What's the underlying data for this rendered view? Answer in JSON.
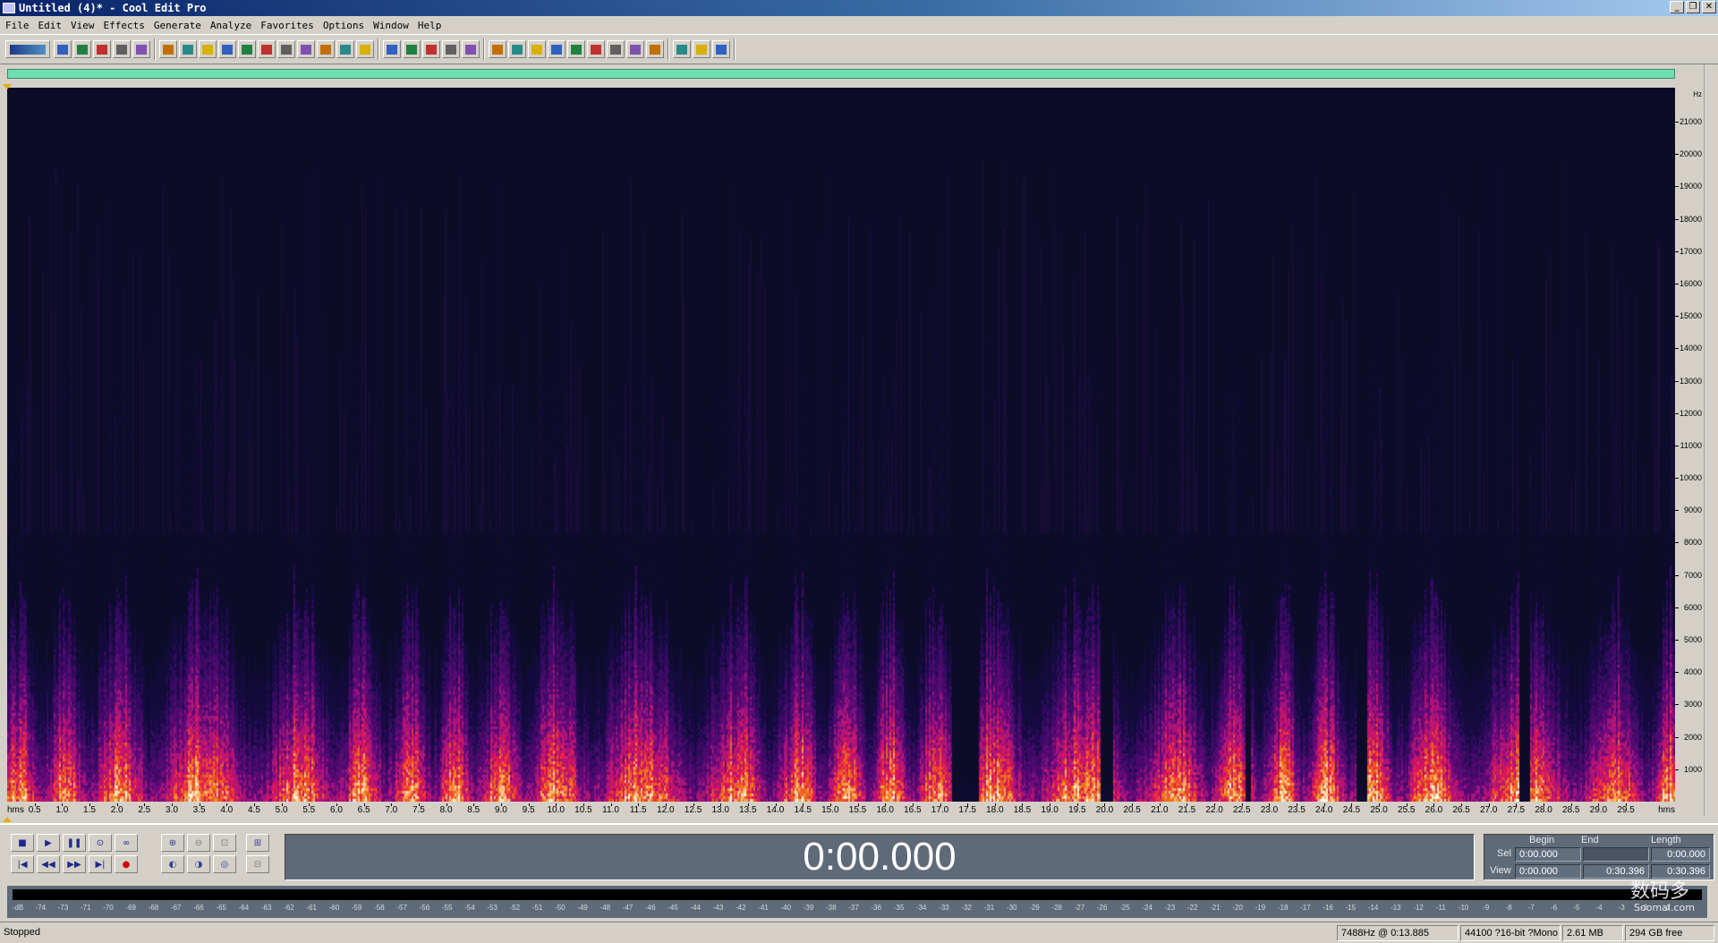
{
  "window": {
    "title": "Untitled (4)* - Cool Edit Pro",
    "controls": [
      "minimize-icon",
      "restore-icon",
      "close-icon"
    ]
  },
  "menu": [
    "File",
    "Edit",
    "View",
    "Effects",
    "Generate",
    "Analyze",
    "Favorites",
    "Options",
    "Window",
    "Help"
  ],
  "toolbar_icons": [
    "waveform-view-icon",
    "new-file-icon",
    "open-file-icon",
    "save-icon",
    "open-append-icon",
    "close-file-icon",
    "undo-icon",
    "redo-icon",
    "repeat-last-icon",
    "copy-icon",
    "copy-new-icon",
    "cut-icon",
    "trim-icon",
    "paste-icon",
    "paste-new-icon",
    "mix-paste-icon",
    "snap-icon",
    "spectral-view-icon",
    "waveform-toggle-icon",
    "zoom-fit-icon",
    "zoom-window-icon",
    "zoom-all-icon",
    "cue-list-icon",
    "play-list-icon",
    "info-icon",
    "scripts-icon",
    "cd-track-icon",
    "time-format-icon",
    "metronome-icon",
    "ruler-icon",
    "frame-icon",
    "settings-icon",
    "favorites-icon",
    "help-icon"
  ],
  "spectrogram": {
    "frequency_unit": "Hz",
    "frequency_labels": [
      "21000",
      "20000",
      "19000",
      "18000",
      "17000",
      "16000",
      "15000",
      "14000",
      "13000",
      "12000",
      "11000",
      "10000",
      "9000",
      "8000",
      "7000",
      "6000",
      "5000",
      "4000",
      "3000",
      "2000",
      "1000"
    ],
    "time_unit_left": "hms",
    "time_unit_right": "hms",
    "time_labels": [
      "0.5",
      "1.0",
      "1.5",
      "2.0",
      "2.5",
      "3.0",
      "3.5",
      "4.0",
      "4.5",
      "5.0",
      "5.5",
      "6.0",
      "6.5",
      "7.0",
      "7.5",
      "8.0",
      "8.5",
      "9.0",
      "9.5",
      "10.0",
      "10.5",
      "11.0",
      "11.5",
      "12.0",
      "12.5",
      "13.0",
      "13.5",
      "14.0",
      "14.5",
      "15.0",
      "15.5",
      "16.0",
      "16.5",
      "17.0",
      "17.5",
      "18.0",
      "18.5",
      "19.0",
      "19.5",
      "20.0",
      "20.5",
      "21.0",
      "21.5",
      "22.0",
      "22.5",
      "23.0",
      "23.5",
      "24.0",
      "24.5",
      "25.0",
      "25.5",
      "26.0",
      "26.5",
      "27.0",
      "27.5",
      "28.0",
      "28.5",
      "29.0",
      "29.5"
    ]
  },
  "transport": {
    "row1_icons": [
      "stop-icon",
      "play-icon",
      "pause-icon",
      "play-to-end-icon",
      "loop-icon"
    ],
    "row2_icons": [
      "go-to-start-icon",
      "rewind-icon",
      "fast-forward-icon",
      "go-to-end-icon",
      "record-icon"
    ],
    "row1_glyphs": [
      "■",
      "▶",
      "❚❚",
      "⊙",
      "∞"
    ],
    "row2_glyphs": [
      "|◀",
      "◀◀",
      "▶▶",
      "▶|",
      "●"
    ]
  },
  "zoom": {
    "row1_icons": [
      "zoom-in-icon",
      "zoom-out-icon",
      "zoom-full-icon",
      "zoom-vertical-in-icon"
    ],
    "row2_icons": [
      "zoom-left-icon",
      "zoom-right-icon",
      "zoom-selection-icon",
      "zoom-vertical-out-icon"
    ]
  },
  "time_display": "0:00.000",
  "selection": {
    "headers": {
      "begin": "Begin",
      "end": "End",
      "length": "Length"
    },
    "sel": {
      "label": "Sel",
      "begin": "0:00.000",
      "end": "",
      "length": "0:00.000"
    },
    "view": {
      "label": "View",
      "begin": "0:00.000",
      "end": "0:30.396",
      "length": "0:30.396"
    }
  },
  "level_meter": {
    "labels": [
      "-dB",
      "-74",
      "-73",
      "-71",
      "-70",
      "-69",
      "-68",
      "-67",
      "-66",
      "-65",
      "-64",
      "-63",
      "-62",
      "-61",
      "-60",
      "-59",
      "-58",
      "-57",
      "-56",
      "-55",
      "-54",
      "-53",
      "-52",
      "-51",
      "-50",
      "-49",
      "-48",
      "-47",
      "-46",
      "-45",
      "-44",
      "-43",
      "-42",
      "-41",
      "-40",
      "-39",
      "-38",
      "-37",
      "-36",
      "-35",
      "-34",
      "-33",
      "-32",
      "-31",
      "-30",
      "-29",
      "-28",
      "-27",
      "-26",
      "-25",
      "-24",
      "-23",
      "-22",
      "-21",
      "-20",
      "-19",
      "-18",
      "-17",
      "-16",
      "-15",
      "-14",
      "-13",
      "-12",
      "-11",
      "-10",
      "-9",
      "-8",
      "-7",
      "-6",
      "-5",
      "-4",
      "-3",
      "-2",
      "-1"
    ]
  },
  "status": {
    "state": "Stopped",
    "cursor": "7488Hz @   0:13.885",
    "format": "44100 ?16-bit ?Mono",
    "size": "2.61 MB",
    "free": "294 GB free"
  },
  "watermark": {
    "main": "数码多",
    "sub": "Soomal.com"
  },
  "colors": {
    "background": "#d4d0c8",
    "spectro_bg": "#0c0b28",
    "overview": "#6de0b0",
    "panel": "#5f6a78"
  }
}
